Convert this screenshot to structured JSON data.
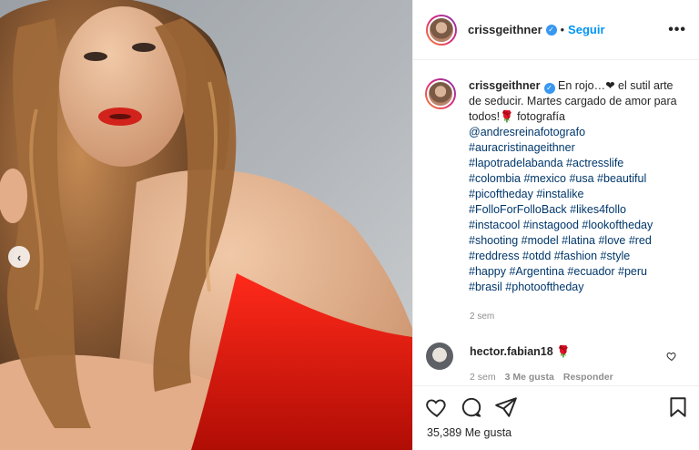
{
  "post": {
    "username": "crissgeithner",
    "verified_icon": "verified-badge-icon",
    "follow_label": "Seguir",
    "separator": "•",
    "more_label": "•••"
  },
  "caption": {
    "username": "crissgeithner",
    "text": "En rojo…❤ el sutil arte de seducir. Martes cargado de amor para todos!🌹 fotografía",
    "mentions": [
      "@andresreinafotografo"
    ],
    "hashtag_lines": [
      "#auracristinageithner",
      "#lapotradelabanda #actresslife",
      "#colombia #mexico #usa #beautiful",
      "#picoftheday #instalike",
      "#FolloForFolloBack #likes4follo",
      "#instacool #instagood #lookoftheday",
      "#shooting #model #latina #love #red",
      "#reddress #otdd #fashion #style",
      "#happy #Argentina #ecuador #peru",
      "#brasil #photooftheday"
    ],
    "time": "2 sem"
  },
  "comment": {
    "username": "hector.fabian18",
    "emoji": "🌹",
    "time": "2 sem",
    "likes": "3 Me gusta",
    "reply_label": "Responder"
  },
  "footer": {
    "likes_count": "35,389 Me gusta"
  },
  "colors": {
    "link_blue": "#0095f6",
    "hashtag": "#00376b",
    "muted": "#8e8e8e"
  }
}
